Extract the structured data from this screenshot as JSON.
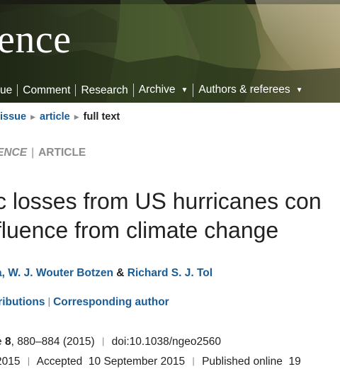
{
  "header": {
    "brand": "ence",
    "nav": [
      {
        "label": "ue",
        "dropdown": false
      },
      {
        "label": "Comment",
        "dropdown": false
      },
      {
        "label": "Research",
        "dropdown": false
      },
      {
        "label": "Archive",
        "dropdown": true
      },
      {
        "label": "Authors & referees",
        "dropdown": true
      }
    ]
  },
  "breadcrumb": {
    "items": [
      "issue",
      "article"
    ],
    "current": "full text"
  },
  "section": {
    "journal": "ENCE",
    "type": "ARTICLE"
  },
  "article": {
    "title_lines": [
      "c losses from US hurricanes con",
      "fluence from climate change"
    ],
    "authors": [
      "a",
      "W. J. Wouter Botzen",
      "Richard S. J. Tol"
    ],
    "author_links": [
      "tributions",
      "Corresponding author"
    ],
    "citation": {
      "volume_prefix": "e",
      "volume": "8",
      "pages": "880–884",
      "year": "(2015)",
      "doi": "doi:10.1038/ngeo2560"
    },
    "dates": {
      "received": "2015",
      "accepted_label": "Accepted",
      "accepted": "10 September 2015",
      "published_label": "Published online",
      "published": "19"
    }
  },
  "colors": {
    "link": "#1a5c96",
    "text": "#222222",
    "muted": "#8c8c8c"
  }
}
